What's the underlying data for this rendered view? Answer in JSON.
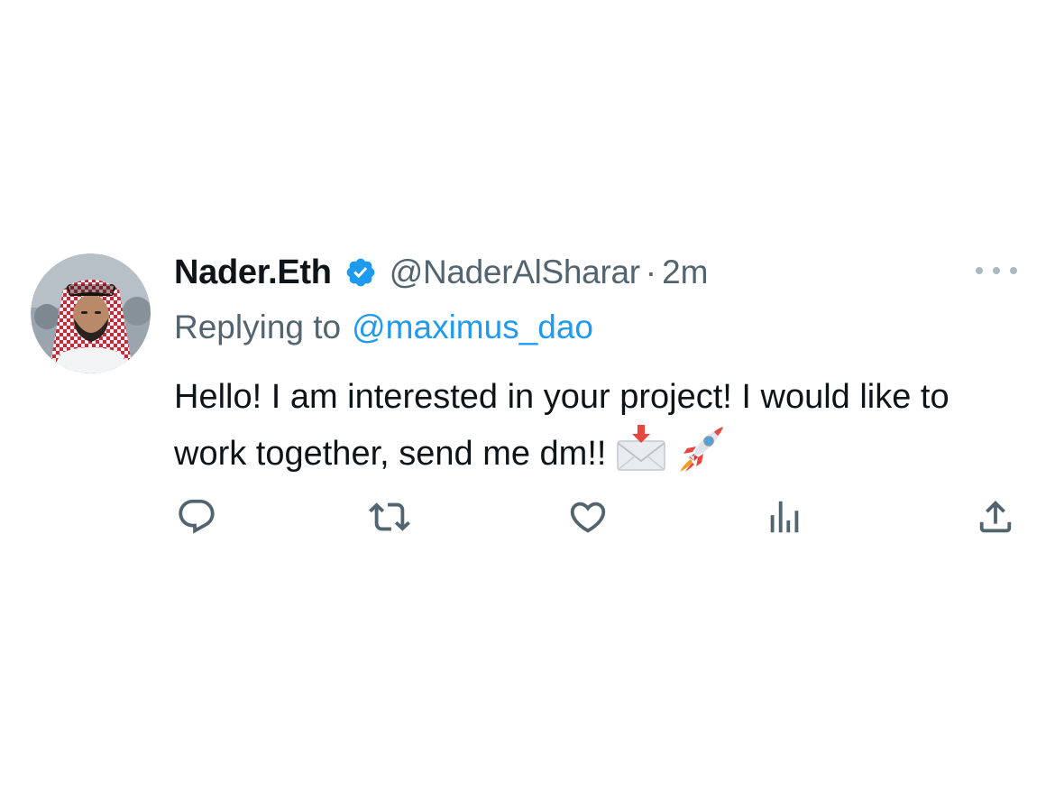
{
  "tweet": {
    "display_name": "Nader.Eth",
    "verified_icon": "verified-badge-icon",
    "handle": "@NaderAlSharar",
    "separator": "·",
    "time": "2m",
    "replying_label": "Replying to",
    "replying_to": "@maximus_dao",
    "text": "Hello! I am interested in your project! I would like to work together, send me dm!!",
    "emojis": [
      "envelope-with-arrow-icon",
      "rocket-icon"
    ]
  },
  "actions": [
    {
      "name": "reply",
      "icon": "reply-bubble-icon"
    },
    {
      "name": "retweet",
      "icon": "retweet-icon"
    },
    {
      "name": "like",
      "icon": "heart-icon"
    },
    {
      "name": "views",
      "icon": "analytics-bars-icon"
    },
    {
      "name": "share",
      "icon": "share-upload-icon"
    }
  ],
  "colors": {
    "text": "#0f1419",
    "secondary": "#536471",
    "accent": "#1d9bf0",
    "more_dots": "#aab8c2"
  }
}
